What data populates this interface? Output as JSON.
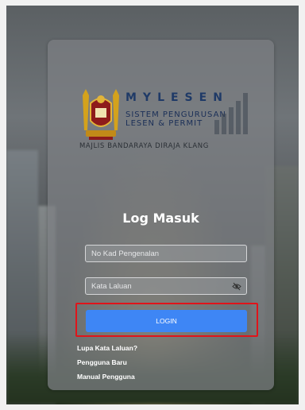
{
  "brand": {
    "name": "MYLESEN",
    "line1": "SISTEM PENGURUSAN",
    "line2": "LESEN & PERMIT",
    "organization": "MAJLIS BANDARAYA DIRAJA KLANG"
  },
  "login": {
    "title": "Log Masuk",
    "id_placeholder": "No Kad Pengenalan",
    "password_placeholder": "Kata Laluan",
    "button_label": "LOGIN"
  },
  "links": [
    {
      "label": "Lupa Kata Laluan?"
    },
    {
      "label": "Pengguna Baru"
    },
    {
      "label": "Manual Pengguna"
    }
  ],
  "colors": {
    "button": "#3e86f5",
    "highlight": "#e0141a",
    "brand_text": "#1f3a67"
  },
  "icons": {
    "password_toggle": "eye-off-icon",
    "emblem": "city-emblem"
  }
}
